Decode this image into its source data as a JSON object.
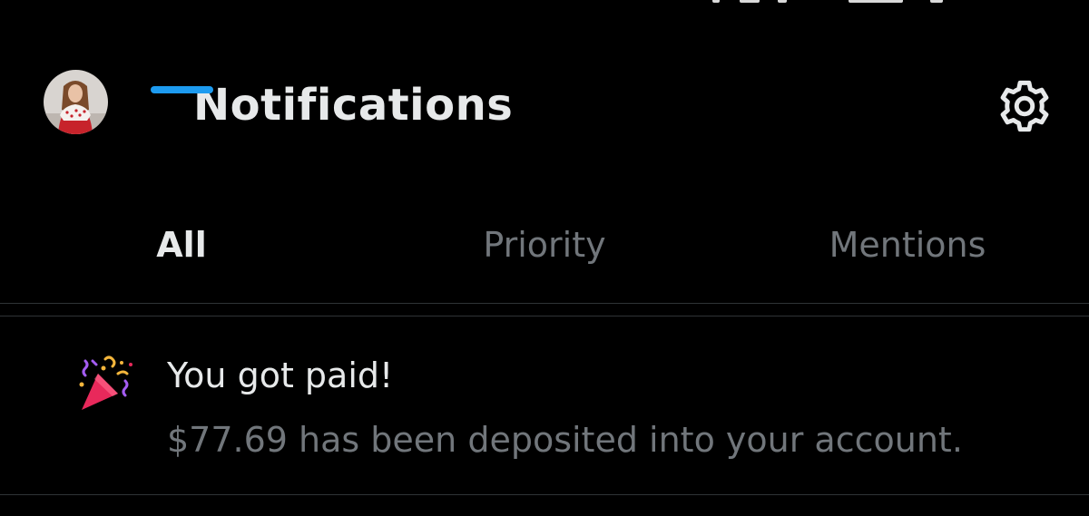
{
  "header": {
    "title": "Notifications",
    "settings_icon": "gear-icon",
    "avatar_icon": "profile-avatar"
  },
  "tabs": [
    {
      "label": "All",
      "active": true
    },
    {
      "label": "Priority",
      "active": false
    },
    {
      "label": "Mentions",
      "active": false
    }
  ],
  "notifications": [
    {
      "icon": "party-popper-icon",
      "title": "You got paid!",
      "body": "$77.69 has been deposited into your account."
    }
  ],
  "colors": {
    "background": "#000000",
    "primary_text": "#e7e9ea",
    "secondary_text": "#71767b",
    "accent": "#1d9bf0",
    "divider": "#2f3336"
  }
}
